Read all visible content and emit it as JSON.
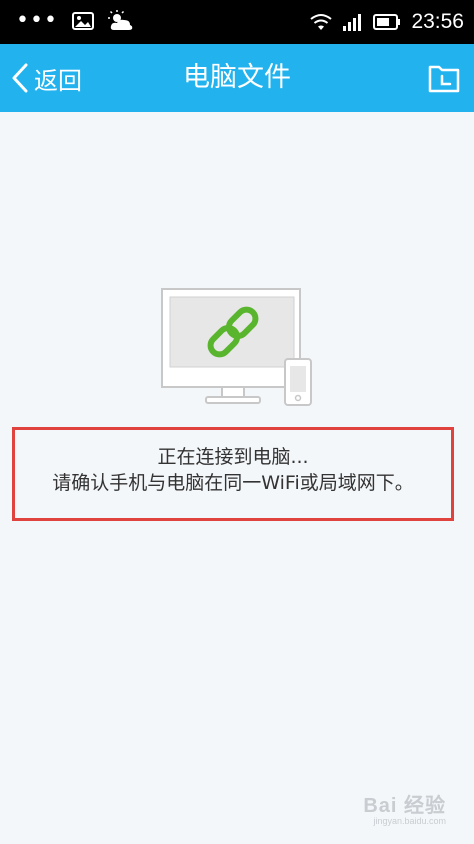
{
  "status": {
    "dots": "•••",
    "time": "23:56"
  },
  "header": {
    "back_label": "返回",
    "title": "电脑文件"
  },
  "main": {
    "status_line": "正在连接到电脑...",
    "hint_line": "请确认手机与电脑在同一WiFi或局域网下。"
  },
  "watermark": {
    "brand": "Bai 经验",
    "url": "jingyan.baidu.com"
  },
  "colors": {
    "accent": "#22b3ef",
    "link_icon": "#5ab52e",
    "highlight_border": "#e0433e"
  }
}
